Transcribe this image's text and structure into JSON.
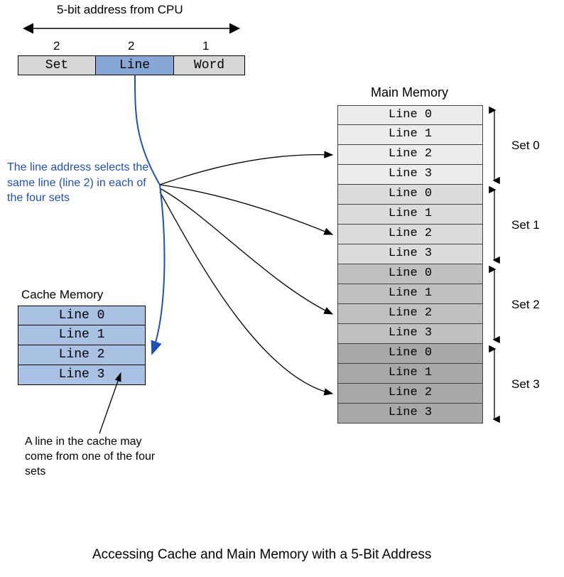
{
  "header": {
    "title": "5-bit address from CPU",
    "bits": {
      "set": "2",
      "line": "2",
      "word": "1"
    },
    "fields": {
      "set": "Set",
      "line": "Line",
      "word": "Word"
    }
  },
  "annotation_line": "The line address selects the same line (line 2) in each of the four sets",
  "cache": {
    "title": "Cache Memory",
    "lines": [
      "Line 0",
      "Line 1",
      "Line 2",
      "Line 3"
    ]
  },
  "cache_note": "A line in the cache may come from one of the four sets",
  "main_memory": {
    "title": "Main Memory",
    "sets": [
      {
        "label": "Set 0",
        "lines": [
          "Line 0",
          "Line 1",
          "Line 2",
          "Line 3"
        ]
      },
      {
        "label": "Set 1",
        "lines": [
          "Line 0",
          "Line 1",
          "Line 2",
          "Line 3"
        ]
      },
      {
        "label": "Set 2",
        "lines": [
          "Line 0",
          "Line 1",
          "Line 2",
          "Line 3"
        ]
      },
      {
        "label": "Set 3",
        "lines": [
          "Line 0",
          "Line 1",
          "Line 2",
          "Line 3"
        ]
      }
    ]
  },
  "caption": "Accessing Cache and Main Memory with a 5-Bit Address",
  "colors": {
    "set0": "#ededed",
    "set1": "#dcdcdc",
    "set2": "#c0c0c0",
    "set3": "#a8a8a8"
  }
}
